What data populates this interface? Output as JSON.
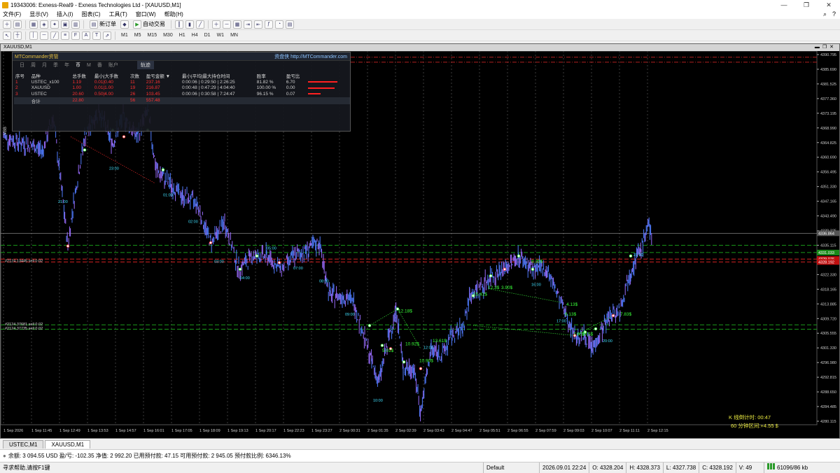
{
  "window": {
    "title": "19343006: Exness-Real9 - Exness Technologies Ltd - [XAUUSD,M1]",
    "minimize": "—",
    "maximize": "❐",
    "close": "✕"
  },
  "menu": [
    "文件(F)",
    "显示(V)",
    "插入(I)",
    "图表(C)",
    "工具(T)",
    "窗口(W)",
    "帮助(H)"
  ],
  "toolbar": {
    "new_order": "新订单",
    "auto_trading": "自动交易",
    "timeframes": [
      "M1",
      "M5",
      "M15",
      "M30",
      "H1",
      "H4",
      "D1",
      "W1",
      "MN"
    ]
  },
  "chart": {
    "caption": "XAUUSD,M1",
    "price_ticks": [
      "4390.795",
      "4385.690",
      "4381.525",
      "4377.360",
      "4373.195",
      "4368.990",
      "4364.825",
      "4360.690",
      "4356.495",
      "4351.330",
      "4347.165",
      "4343.490",
      "4339.325",
      "4335.115",
      "4326.495",
      "4322.330",
      "4318.165",
      "4313.885",
      "4309.720",
      "4305.555",
      "4301.330",
      "4296.980",
      "4292.815",
      "4288.650",
      "4284.485",
      "4280.115"
    ],
    "time_ticks": [
      "1 Sep 2026",
      "1 Sep 11:45",
      "1 Sep 12:49",
      "1 Sep 13:53",
      "1 Sep 14:57",
      "1 Sep 16:01",
      "1 Sep 17:05",
      "1 Sep 18:09",
      "1 Sep 19:13",
      "1 Sep 20:17",
      "1 Sep 22:23",
      "1 Sep 23:27",
      "2 Sep 00:31",
      "2 Sep 01:35",
      "2 Sep 02:39",
      "2 Sep 03:43",
      "2 Sep 04:47",
      "2 Sep 05:51",
      "2 Sep 06:55",
      "2 Sep 07:59",
      "2 Sep 09:03",
      "2 Sep 10:07",
      "2 Sep 11:11",
      "2 Sep 12:15"
    ],
    "price_labels": {
      "current": "4336.864",
      "green": "4331.033",
      "red1": "4329.076",
      "red2": "4328.192"
    },
    "order_line_1": "#2124.13445 sell 0.02",
    "order_line_2": "#2124.37681 sell 0.02",
    "order_line_3": "#2124.37735 sell 0.02",
    "trade_labels": [
      "12.18$",
      "10.92$",
      "5.01$",
      "10.90$",
      "13.61$",
      "15.41$",
      "12.3$",
      "3.90$",
      "4.13$",
      "6.13$",
      "7.90$",
      "10.5$",
      "7.83$",
      "8.35$"
    ],
    "hour_labels": [
      "21:00",
      "23:00",
      "01:00",
      "02:00",
      "03:00",
      "04:00",
      "05:00",
      "07:00",
      "08:00",
      "09:00",
      "10:00",
      "12:00",
      "16:00",
      "17:00",
      "20:00",
      "21:00"
    ],
    "countdown": "K 线倒计时: 00:47",
    "range_info": "60 分钟区间:+4.55 $",
    "side_label": "VBB"
  },
  "panel": {
    "title": "MTCommander资管",
    "link": "资盘侠 http://MTCommander.com",
    "tabs": [
      "日",
      "周",
      "月",
      "季",
      "年",
      "币",
      "M",
      "番",
      "账户"
    ],
    "active_tab": "币",
    "track_btn": "轨迹",
    "headers": [
      "序号",
      "品种",
      "总手数",
      "最小|大手数",
      "次数",
      "盈亏金额 ▼",
      "最小|平均|最大持仓时间",
      "胜率",
      "盈亏比"
    ],
    "rows": [
      {
        "idx": "1",
        "symbol": "USTEC_x100",
        "lots": "1.19",
        "minmax": "0.01|0.40",
        "count": "11",
        "pnl": "237.16",
        "hold": "0:00:06 | 0:29:50 | 2:26:25",
        "win": "81.82 %",
        "ratio": "6.70",
        "bar": 0.95
      },
      {
        "idx": "2",
        "symbol": "XAUUSD",
        "lots": "1.00",
        "minmax": "0.01|1.00",
        "count": "19",
        "pnl": "216.87",
        "hold": "0:00:48 | 0:47:29 | 4:04:40",
        "win": "100.00 %",
        "ratio": "0.00",
        "bar": 0.86
      },
      {
        "idx": "3",
        "symbol": "USTEC",
        "lots": "20.60",
        "minmax": "0.50|4.00",
        "count": "26",
        "pnl": "103.45",
        "hold": "0:00:06 | 0:30:58 | 7:24:47",
        "win": "96.15 %",
        "ratio": "0.07",
        "bar": 0.41
      }
    ],
    "total": {
      "label": "合计",
      "lots": "22.80",
      "count": "56",
      "pnl": "557.48"
    }
  },
  "tabs": [
    "USTEC,M1",
    "XAUUSD,M1"
  ],
  "active_chart_tab": "XAUUSD,M1",
  "account": {
    "line": "余额: 3 094.55 USD  盈/亏: -102.35  净值: 2 992.20  已用预付款: 47.15  可用预付款: 2 945.05  预付款比例: 6346.13%"
  },
  "status": {
    "help": "寻求帮助,请按F1键",
    "profile": "Default",
    "datetime": "2026.09.01 22:24",
    "open": "O: 4328.204",
    "high": "H: 4328.373",
    "low": "L: 4327.738",
    "close": "C: 4328.192",
    "volume": "V: 49",
    "traffic": "61096/86 kb"
  },
  "colors": {
    "bg": "#000000",
    "candle": "#4f7cff",
    "candle_alt": "#9b6dff",
    "profit": "#39ff39",
    "loss": "#ff3030",
    "grid": "#333333"
  }
}
